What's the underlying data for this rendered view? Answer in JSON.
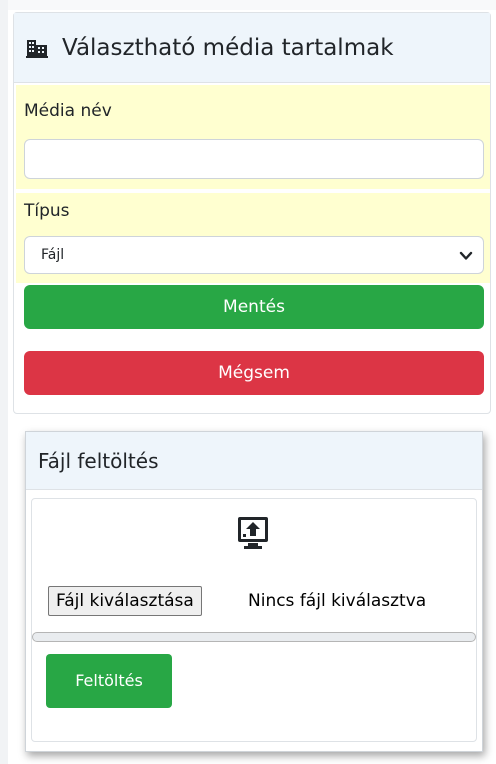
{
  "panel": {
    "title": "Választható média tartalmak",
    "header_icon": "building-icon"
  },
  "form": {
    "name_label": "Média név",
    "name_value": "",
    "type_label": "Típus",
    "type_value": "Fájl",
    "save_label": "Mentés",
    "cancel_label": "Mégsem"
  },
  "upload": {
    "title": "Fájl feltöltés",
    "icon": "upload-monitor-icon",
    "choose_file_label": "Fájl kiválasztása",
    "file_status": "Nincs fájl kiválasztva",
    "progress": 0,
    "upload_label": "Feltöltés"
  },
  "colors": {
    "header_bg": "#eef5fb",
    "highlight_bg": "#ffffd0",
    "success": "#28a745",
    "danger": "#dc3545"
  }
}
